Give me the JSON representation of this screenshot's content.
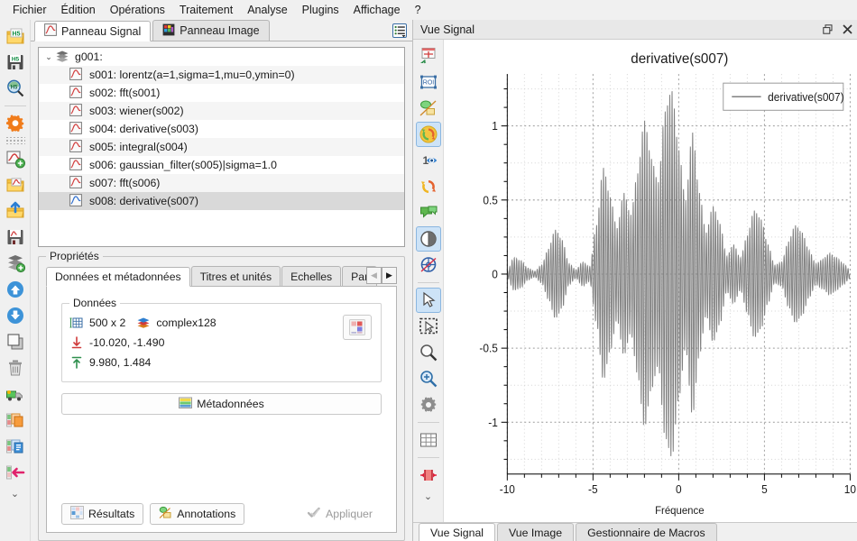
{
  "app": {
    "menu": [
      "Fichier",
      "Édition",
      "Opérations",
      "Traitement",
      "Analyse",
      "Plugins",
      "Affichage",
      "?"
    ]
  },
  "left_toolbar": {
    "items": [
      {
        "name": "open-hdf5-icon",
        "title": "Ouvrir HDF5"
      },
      {
        "name": "save-hdf5-icon",
        "title": "Enregistrer HDF5"
      },
      {
        "name": "browse-hdf5-icon",
        "title": "Parcourir HDF5"
      },
      {
        "name": "settings-gear-icon",
        "title": "Paramètres"
      },
      {
        "name": "new-signal-icon",
        "title": "Nouveau signal"
      },
      {
        "name": "open-signal-icon",
        "title": "Ouvrir signal"
      },
      {
        "name": "import-signal-icon",
        "title": "Importer"
      },
      {
        "name": "save-signal-icon",
        "title": "Enregistrer signal"
      },
      {
        "name": "new-group-icon",
        "title": "Nouveau groupe"
      },
      {
        "name": "move-up-icon",
        "title": "Monter"
      },
      {
        "name": "move-down-icon",
        "title": "Descendre"
      },
      {
        "name": "duplicate-icon",
        "title": "Dupliquer"
      },
      {
        "name": "delete-icon",
        "title": "Supprimer"
      },
      {
        "name": "move-group-icon",
        "title": "Déplacer"
      },
      {
        "name": "copy-icon",
        "title": "Copier"
      },
      {
        "name": "paste-icon",
        "title": "Coller"
      },
      {
        "name": "insert-icon",
        "title": "Insérer"
      }
    ],
    "overflow_label": "⌄"
  },
  "panel_tabs": {
    "items": [
      {
        "label": "Panneau Signal",
        "icon": "signal-panel-icon",
        "active": true
      },
      {
        "label": "Panneau Image",
        "icon": "image-panel-icon",
        "active": false
      }
    ],
    "list_button": "tab-list-icon"
  },
  "tree": {
    "group": {
      "label": "g001:",
      "icon": "group-stack-icon",
      "expanded": true,
      "arrow": "⌄"
    },
    "items": [
      {
        "label": "s001: lorentz(a=1,sigma=1,mu=0,ymin=0)",
        "selected": false
      },
      {
        "label": "s002: fft(s001)",
        "selected": false
      },
      {
        "label": "s003: wiener(s002)",
        "selected": false
      },
      {
        "label": "s004: derivative(s003)",
        "selected": false
      },
      {
        "label": "s005: integral(s004)",
        "selected": false
      },
      {
        "label": "s006: gaussian_filter(s005)|sigma=1.0",
        "selected": false
      },
      {
        "label": "s007: fft(s006)",
        "selected": false
      },
      {
        "label": "s008: derivative(s007)",
        "selected": true
      }
    ]
  },
  "properties": {
    "title": "Propriétés",
    "tabs": [
      {
        "label": "Données et métadonnées",
        "active": true
      },
      {
        "label": "Titres et unités",
        "active": false
      },
      {
        "label": "Echelles",
        "active": false
      },
      {
        "label": "Para",
        "active": false,
        "clipped": true
      }
    ],
    "nav_prev": "◀",
    "nav_next": "▶",
    "data_group": {
      "title": "Données",
      "shape": "500 x 2",
      "dtype": "complex128",
      "min": "-10.020, -1.490",
      "max": "9.980, 1.484",
      "shape_icon": "grid-size-icon",
      "dtype_icon": "datatype-layers-icon",
      "min_icon": "min-arrow-down-icon",
      "max_icon": "max-arrow-up-icon",
      "palette_button": "color-palette-icon"
    },
    "metadata_button": {
      "label": "Métadonnées",
      "icon": "metadata-icon"
    },
    "footer": {
      "results": {
        "label": "Résultats",
        "icon": "results-grid-icon"
      },
      "annotations": {
        "label": "Annotations",
        "icon": "annotations-icon"
      },
      "apply": {
        "label": "Appliquer",
        "icon": "check-icon",
        "disabled": true
      }
    }
  },
  "signal_view": {
    "title": "Vue Signal",
    "restore_icon": "restore-window-icon",
    "close_icon": "close-icon",
    "toolbar": [
      {
        "name": "new-curve-icon",
        "active": false
      },
      {
        "name": "roi-icon",
        "active": false
      },
      {
        "name": "shapes-icon",
        "active": false
      },
      {
        "name": "refresh-auto-icon",
        "active": true
      },
      {
        "name": "display-one-icon",
        "active": false
      },
      {
        "name": "refresh-icon",
        "active": false
      },
      {
        "name": "annotation-bubble-icon",
        "active": false
      },
      {
        "name": "contrast-icon",
        "active": true
      },
      {
        "name": "no-cross-section-icon",
        "active": false
      },
      {
        "name": "select-cursor-icon",
        "active": true
      },
      {
        "name": "rect-selection-icon",
        "active": false
      },
      {
        "name": "zoom-out-icon",
        "active": false
      },
      {
        "name": "zoom-in-icon",
        "active": false
      },
      {
        "name": "plot-settings-icon",
        "active": false
      },
      {
        "name": "grid-icon",
        "active": false
      },
      {
        "name": "x-range-icon",
        "active": false
      }
    ],
    "overflow_label": "⌄"
  },
  "bottom_tabs": [
    {
      "label": "Vue Signal",
      "active": true
    },
    {
      "label": "Vue Image",
      "active": false
    },
    {
      "label": "Gestionnaire de Macros",
      "active": false
    }
  ],
  "chart_data": {
    "type": "line",
    "title": "derivative(s007)",
    "xlabel": "Fréquence",
    "ylabel": "",
    "legend": [
      "derivative(s007)"
    ],
    "legend_position": "top-right",
    "grid": true,
    "xlim": [
      -10,
      10
    ],
    "ylim": [
      -1.35,
      1.35
    ],
    "xticks": [
      -10,
      -5,
      0,
      5,
      10
    ],
    "yticks": [
      1,
      0.5,
      0,
      -0.5,
      -1
    ],
    "series_color": "#808080",
    "carrier_cycles": 150,
    "envelope_x": [
      -10.02,
      -9.6,
      -9.2,
      -8.8,
      -8.4,
      -8.0,
      -7.6,
      -7.2,
      -6.8,
      -6.4,
      -6.0,
      -5.6,
      -5.2,
      -4.8,
      -4.4,
      -4.0,
      -3.6,
      -3.2,
      -2.8,
      -2.4,
      -2.0,
      -1.6,
      -1.2,
      -0.8,
      -0.4,
      0.0,
      0.4,
      0.8,
      1.2,
      1.6,
      2.0,
      2.4,
      2.8,
      3.2,
      3.6,
      4.0,
      4.4,
      4.8,
      5.2,
      5.6,
      6.0,
      6.4,
      6.8,
      7.2,
      7.6,
      8.0,
      8.4,
      8.8,
      9.2,
      9.6,
      9.98
    ],
    "envelope_y": [
      0.02,
      0.11,
      0.09,
      0.04,
      0.02,
      0.06,
      0.17,
      0.3,
      0.23,
      0.07,
      0.03,
      0.08,
      0.05,
      0.33,
      0.72,
      0.52,
      0.31,
      0.55,
      0.4,
      0.68,
      1.04,
      0.78,
      0.62,
      1.1,
      1.24,
      0.84,
      0.5,
      0.96,
      0.55,
      0.28,
      0.46,
      0.34,
      0.12,
      0.2,
      0.11,
      0.26,
      0.43,
      0.37,
      0.2,
      0.06,
      0.08,
      0.22,
      0.33,
      0.28,
      0.16,
      0.07,
      0.1,
      0.14,
      0.11,
      0.07,
      0.03
    ],
    "note": "Dense oscillatory signal with modulated envelope; amplitude peaks near x=-0.4 reaching approximately +/-1.3"
  }
}
